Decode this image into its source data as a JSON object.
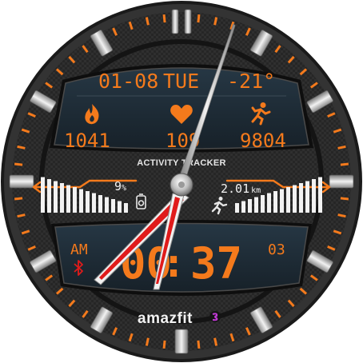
{
  "watch": {
    "date": "01-08",
    "weekday": "TUE",
    "temperature": "-21°",
    "calories": "1041",
    "heart_rate": "109",
    "steps": "9804",
    "activity_label": "ACTIVITY TRACKER",
    "battery_percent": "9",
    "battery_unit": "%",
    "distance": "2.01",
    "distance_unit": "km",
    "am_pm": "AM",
    "hours": "00",
    "colon": ":",
    "minutes": "37",
    "seconds": "03",
    "brand": "amazfit",
    "battery_level": 0.09,
    "distance_progress": 0.5
  },
  "colors": {
    "accent": "#f47a1c",
    "panel": "#1f2c36",
    "bezel": "#2a2a2a",
    "hand_red": "#e01b1b"
  },
  "icons": {
    "calories": "flame-icon",
    "heart": "heart-icon",
    "steps": "running-person-icon",
    "battery": "battery-icon",
    "walker": "walking-person-icon",
    "bluetooth": "bluetooth-icon",
    "brand_badge": "brand-badge-icon"
  }
}
